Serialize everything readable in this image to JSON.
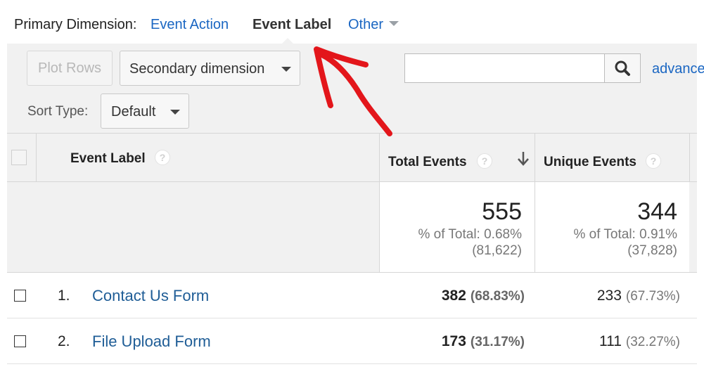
{
  "primary_dimension": {
    "label": "Primary Dimension:",
    "options": [
      "Event Action",
      "Event Label",
      "Other"
    ],
    "active": "Event Label"
  },
  "toolbar": {
    "plot_rows": "Plot Rows",
    "secondary_dimension": "Secondary dimension",
    "search_placeholder": "",
    "advanced": "advanced",
    "sort_type_label": "Sort Type:",
    "sort_type_value": "Default"
  },
  "table": {
    "columns": {
      "event_label": "Event Label",
      "total_events": "Total Events",
      "unique_events": "Unique Events"
    },
    "totals": {
      "total_events": {
        "value": "555",
        "pct": "% of Total: 0.68%",
        "of": "(81,622)"
      },
      "unique_events": {
        "value": "344",
        "pct": "% of Total: 0.91%",
        "of": "(37,828)"
      }
    },
    "rows": [
      {
        "num": "1.",
        "label": "Contact Us Form",
        "total": "382",
        "total_pct": "(68.83%)",
        "unique": "233",
        "unique_pct": "(67.73%)"
      },
      {
        "num": "2.",
        "label": "File Upload Form",
        "total": "173",
        "total_pct": "(31.17%)",
        "unique": "111",
        "unique_pct": "(32.27%)"
      }
    ]
  },
  "colors": {
    "link_blue": "#1a66c2",
    "row_link_blue": "#1f5d96",
    "annotation_red": "#e3161b",
    "header_bg": "#f1f1f1"
  },
  "icons": {
    "search": "magnifier-icon",
    "sort": "arrow-down-icon",
    "help": "question-icon"
  }
}
